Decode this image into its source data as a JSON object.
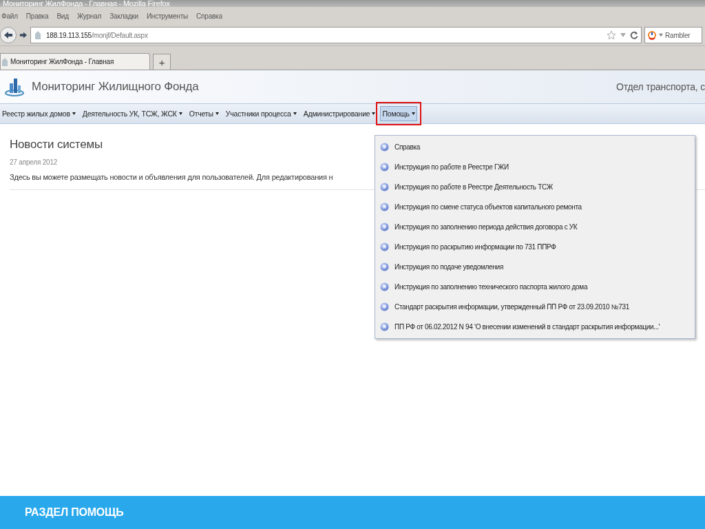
{
  "window": {
    "title": "Мониторинг ЖилФонда - Главная - Mozilla Firefox"
  },
  "menu_bar": [
    "Файл",
    "Правка",
    "Вид",
    "Журнал",
    "Закладки",
    "Инструменты",
    "Справка"
  ],
  "address_bar": {
    "host": "188.19.113.155",
    "path": "/monjf/Default.aspx"
  },
  "search_engine": "Rambler",
  "tabs": [
    {
      "label": "Мониторинг ЖилФонда - Главная",
      "selected": true
    }
  ],
  "new_tab": "+",
  "site": {
    "title": "Мониторинг Жилищного Фонда",
    "user": "Отдел транспорта, с"
  },
  "nav": [
    {
      "label": "Реестр жилых домов",
      "selected": false,
      "highlighted": false
    },
    {
      "label": "Деятельность УК, ТСЖ, ЖСК",
      "selected": false,
      "highlighted": false
    },
    {
      "label": "Отчеты",
      "selected": false,
      "highlighted": false
    },
    {
      "label": "Участники процесса",
      "selected": false,
      "highlighted": false
    },
    {
      "label": "Администрирование",
      "selected": false,
      "highlighted": false
    },
    {
      "label": "Помощь",
      "selected": true,
      "highlighted": true
    }
  ],
  "help_menu": [
    "Справка",
    "Инструкция по работе в Реестре ГЖИ",
    "Инструкция по работе в Реестре Деятельность ТСЖ",
    "Инструкция по смене статуса объектов капитального ремонта",
    "Инструкция по заполнению периода действия договора с УК",
    "Инструкция по раскрытию информации по 731 ППРФ",
    "Инструкция по подаче уведомления",
    "Инструкция по заполнению технического паспорта жилого дома",
    "Стандарт раскрытия информации, утвержденный ПП РФ от 23.09.2010 №731",
    "ПП РФ от 06.02.2012 N 94 'О внесении изменений в стандарт раскрытия информации...'"
  ],
  "news": {
    "title": "Новости системы",
    "date": "27 апреля 2012",
    "text": "Здесь вы можете размещать новости и объявления для пользователей. Для редактирования н"
  },
  "caption": "РАЗДЕЛ ПОМОЩЬ"
}
